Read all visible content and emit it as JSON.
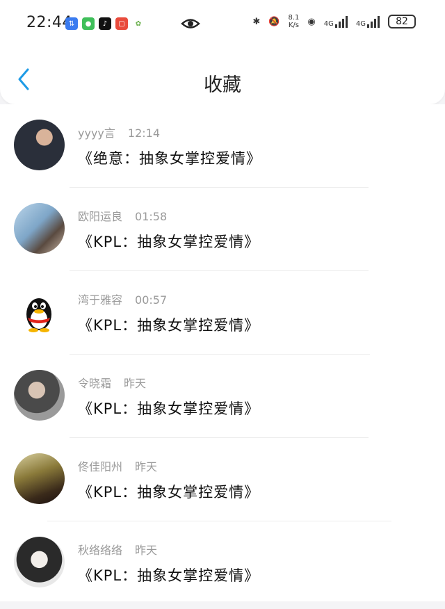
{
  "status_bar": {
    "time": "22:44",
    "network_speed_value": "8.1",
    "network_speed_unit": "K/s",
    "signal1_label": "4G",
    "signal2_label": "4G",
    "battery": "82",
    "icons": [
      "app-icon-blue",
      "wechat-icon",
      "tiktok-icon",
      "red-app-icon",
      "bird-app-icon",
      "eye-icon",
      "bluetooth-icon",
      "mute-bell-icon",
      "hotspot-icon",
      "signal-icon",
      "signal-icon",
      "battery-icon"
    ]
  },
  "header": {
    "title": "收藏",
    "back_icon": "chevron-left-icon",
    "accent": "#1e9be6"
  },
  "items": [
    {
      "name": "yyyy言",
      "time": "12:14",
      "text": "《绝意：抽象女掌控爱情》"
    },
    {
      "name": "欧阳运良",
      "time": "01:58",
      "text": "《KPL：抽象女掌控爱情》"
    },
    {
      "name": "湾于雅容",
      "time": "00:57",
      "text": "《KPL：抽象女掌控爱情》"
    },
    {
      "name": "令晓霜",
      "time": "昨天",
      "text": "《KPL：抽象女掌控爱情》"
    },
    {
      "name": "佟佳阳州",
      "time": "昨天",
      "text": "《KPL：抽象女掌控爱情》"
    },
    {
      "name": "秋络络络",
      "time": "昨天",
      "text": "《KPL：抽象女掌控爱情》"
    }
  ]
}
